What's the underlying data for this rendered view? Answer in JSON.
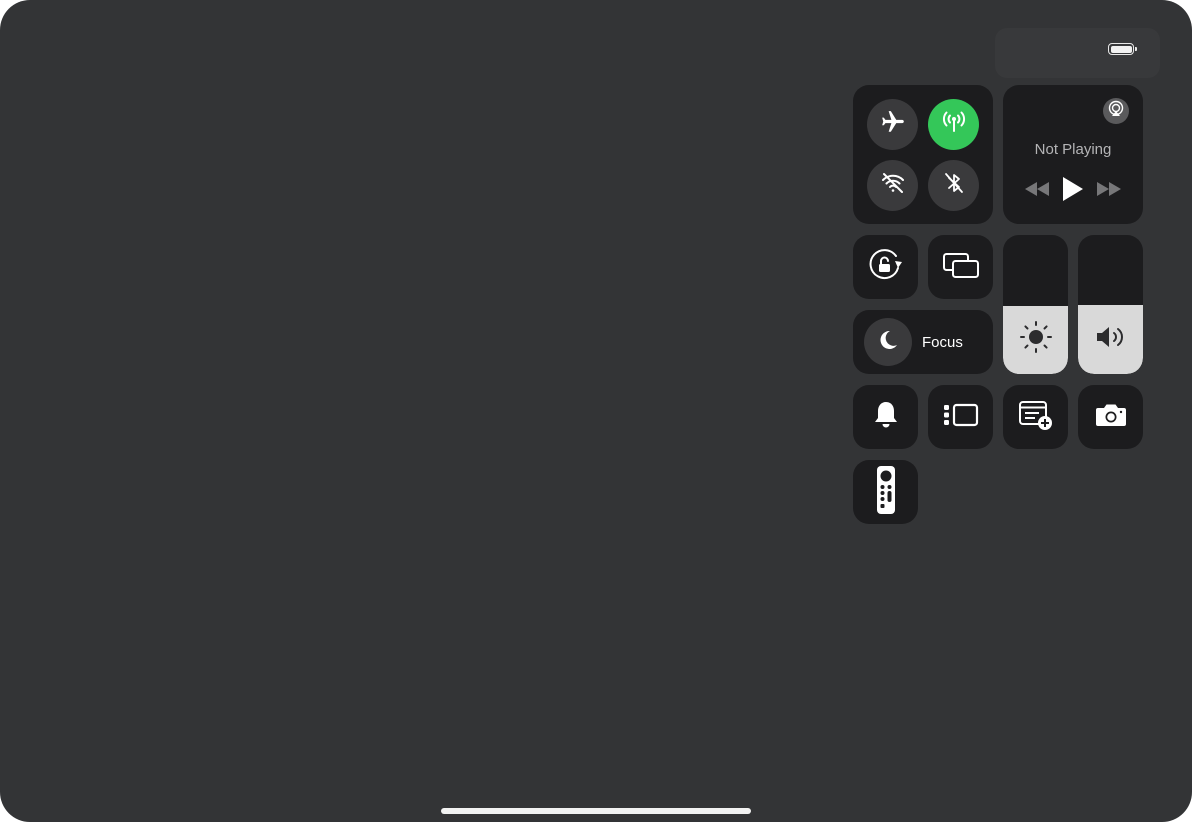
{
  "now_playing": {
    "status": "Not Playing"
  },
  "focus": {
    "label": "Focus"
  },
  "brightness": {
    "level": 0.49
  },
  "volume": {
    "level": 0.5
  },
  "icons": {
    "airplane": "airplane-icon",
    "cellular": "cellular-data-icon",
    "wifi": "wifi-off-icon",
    "bluetooth": "bluetooth-off-icon",
    "airplay": "airplay-icon",
    "rewind": "rewind-icon",
    "play": "play-icon",
    "fast_forward": "fast-forward-icon",
    "rotation_lock": "rotation-lock-icon",
    "screen_mirroring": "screen-mirroring-icon",
    "moon": "moon-icon",
    "sun": "sun-icon",
    "speaker": "speaker-icon",
    "bell": "bell-icon",
    "stage_manager": "stage-manager-icon",
    "quick_note": "quick-note-icon",
    "camera": "camera-icon",
    "remote": "apple-tv-remote-icon"
  },
  "colors": {
    "background": "#333436",
    "tile": "#1c1c1e",
    "button": "#3a3a3c",
    "cellular_active": "#34c759",
    "slider_fill": "#d9d9d9"
  }
}
